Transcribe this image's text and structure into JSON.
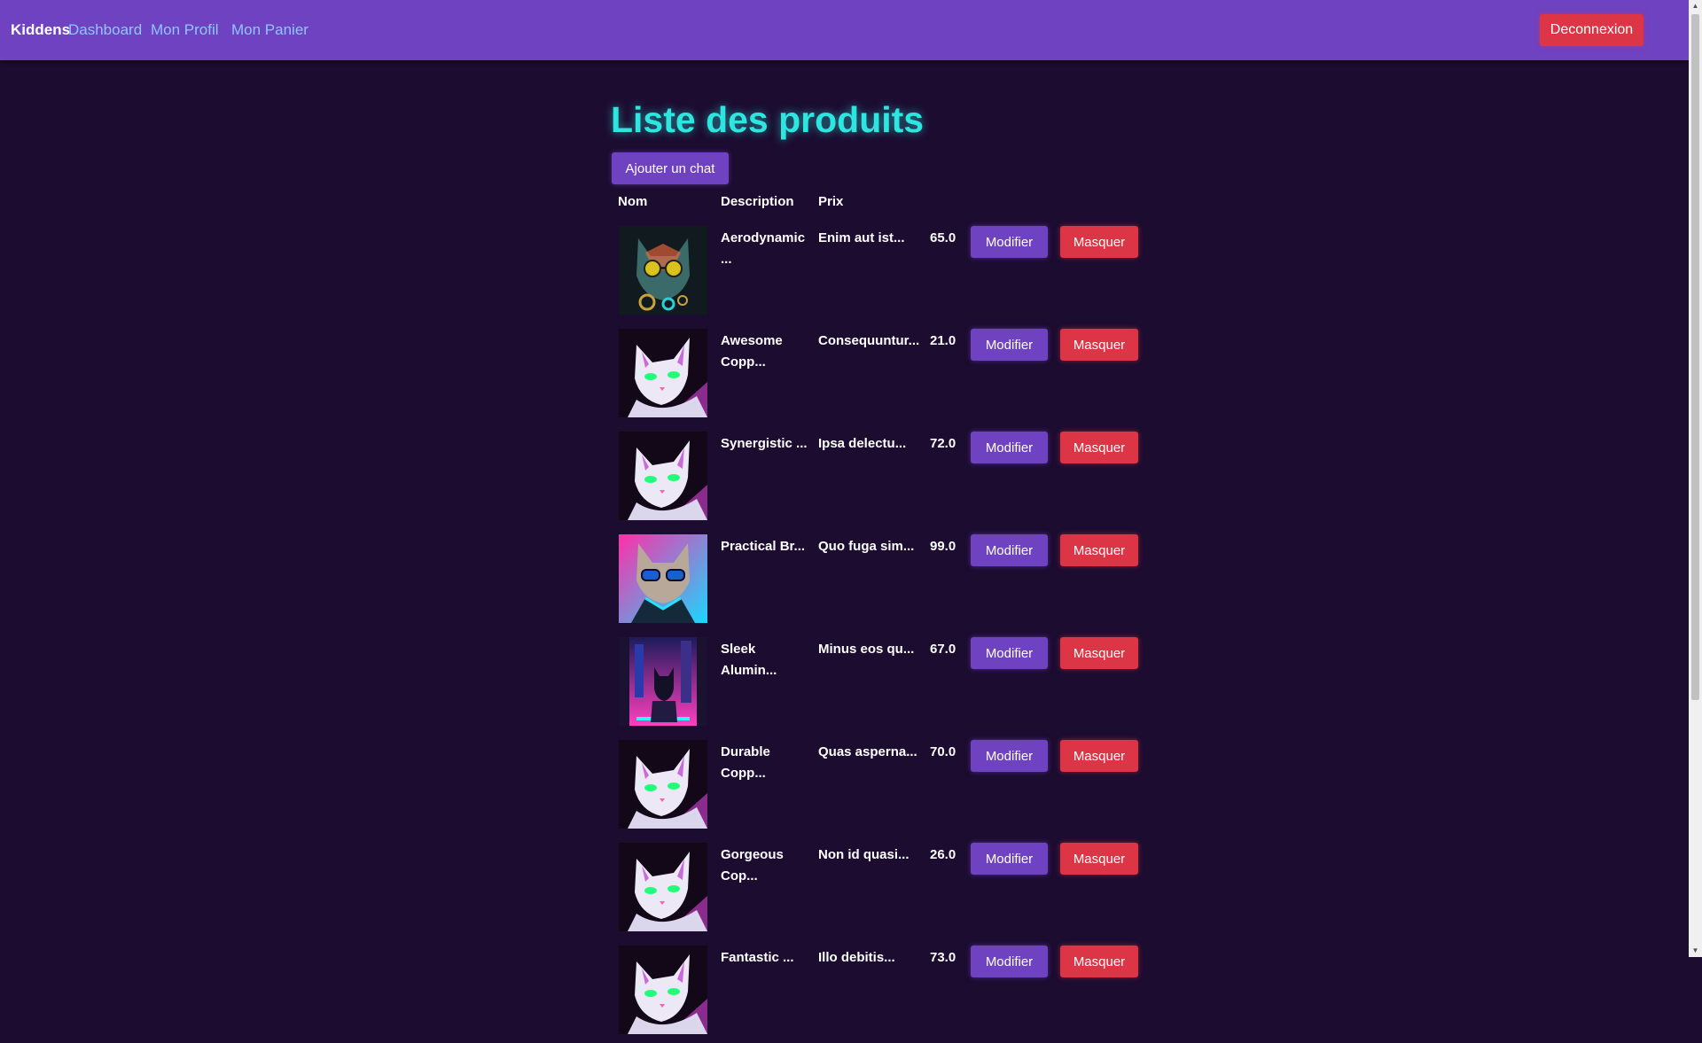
{
  "navbar": {
    "brand": "Kiddens",
    "links": [
      "Dashboard",
      "Mon Profil",
      "Mon Panier"
    ],
    "logout_label": "Deconnexion"
  },
  "page": {
    "title": "Liste des produits",
    "add_button_label": "Ajouter un chat"
  },
  "table": {
    "columns": [
      "Nom",
      "Description",
      "Prix"
    ],
    "edit_label": "Modifier",
    "hide_label": "Masquer",
    "rows": [
      {
        "name": "Aerodynamic ...",
        "description": "Enim aut ist...",
        "price": "65.0",
        "image": "cat-goggles-icon"
      },
      {
        "name": "Awesome Copp...",
        "description": "Consequuntur...",
        "price": "21.0",
        "image": "white-cat-icon"
      },
      {
        "name": "Synergistic ...",
        "description": "Ipsa delectu...",
        "price": "72.0",
        "image": "white-cat-icon"
      },
      {
        "name": "Practical Br...",
        "description": "Quo fuga sim...",
        "price": "99.0",
        "image": "neon-cat-sunglasses-icon"
      },
      {
        "name": "Sleek Alumin...",
        "description": "Minus eos qu...",
        "price": "67.0",
        "image": "city-cat-icon"
      },
      {
        "name": "Durable Copp...",
        "description": "Quas asperna...",
        "price": "70.0",
        "image": "white-cat-icon"
      },
      {
        "name": "Gorgeous Cop...",
        "description": "Non id quasi...",
        "price": "26.0",
        "image": "white-cat-icon"
      },
      {
        "name": "Fantastic ...",
        "description": "Illo debitis...",
        "price": "73.0",
        "image": "white-cat-icon"
      }
    ]
  }
}
